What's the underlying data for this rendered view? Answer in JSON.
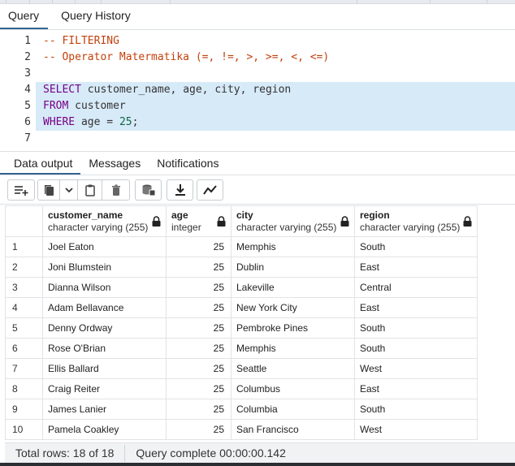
{
  "query_tabs": [
    {
      "label": "Query",
      "active": true
    },
    {
      "label": "Query History",
      "active": false
    }
  ],
  "editor": {
    "lines": [
      {
        "n": "1",
        "tokens": [
          {
            "t": "-- FILTERING",
            "c": "comment"
          }
        ]
      },
      {
        "n": "2",
        "tokens": [
          {
            "t": "-- Operator Matermatika (=, !=, >, >=, <, <=)",
            "c": "comment"
          }
        ]
      },
      {
        "n": "3",
        "tokens": []
      },
      {
        "n": "4",
        "tokens": [
          {
            "t": "SELECT",
            "c": "kw"
          },
          {
            "t": " customer_name, age, city, region",
            "c": "plain"
          }
        ],
        "selected": true
      },
      {
        "n": "5",
        "tokens": [
          {
            "t": "FROM",
            "c": "kw"
          },
          {
            "t": " customer",
            "c": "plain"
          }
        ],
        "selected": true
      },
      {
        "n": "6",
        "tokens": [
          {
            "t": "WHERE",
            "c": "kw"
          },
          {
            "t": " age = ",
            "c": "plain"
          },
          {
            "t": "25",
            "c": "num"
          },
          {
            "t": ";",
            "c": "plain"
          }
        ],
        "selected": true
      },
      {
        "n": "7",
        "tokens": []
      }
    ]
  },
  "output_tabs": [
    {
      "label": "Data output",
      "active": true
    },
    {
      "label": "Messages",
      "active": false
    },
    {
      "label": "Notifications",
      "active": false
    }
  ],
  "toolbar": {
    "icons": [
      "add-row-icon",
      "copy-icon",
      "chevron-down-icon",
      "paste-icon",
      "delete-icon",
      "save-data-icon",
      "download-icon",
      "graph-icon"
    ]
  },
  "grid": {
    "columns": [
      {
        "name": "customer_name",
        "type": "character varying (255)"
      },
      {
        "name": "age",
        "type": "integer"
      },
      {
        "name": "city",
        "type": "character varying (255)"
      },
      {
        "name": "region",
        "type": "character varying (255)"
      }
    ],
    "rows": [
      [
        "1",
        "Joel Eaton",
        "25",
        "Memphis",
        "South"
      ],
      [
        "2",
        "Joni Blumstein",
        "25",
        "Dublin",
        "East"
      ],
      [
        "3",
        "Dianna Wilson",
        "25",
        "Lakeville",
        "Central"
      ],
      [
        "4",
        "Adam Bellavance",
        "25",
        "New York City",
        "East"
      ],
      [
        "5",
        "Denny Ordway",
        "25",
        "Pembroke Pines",
        "South"
      ],
      [
        "6",
        "Rose O'Brian",
        "25",
        "Memphis",
        "South"
      ],
      [
        "7",
        "Ellis Ballard",
        "25",
        "Seattle",
        "West"
      ],
      [
        "8",
        "Craig Reiter",
        "25",
        "Columbus",
        "East"
      ],
      [
        "9",
        "James Lanier",
        "25",
        "Columbia",
        "South"
      ],
      [
        "10",
        "Pamela Coakley",
        "25",
        "San Francisco",
        "West"
      ]
    ]
  },
  "status": {
    "total_rows": "Total rows: 18 of 18",
    "query_complete": "Query complete 00:00:00.142"
  },
  "colors": {
    "accent": "#326690",
    "selection": "#d7eaf8",
    "comment": "#c2410c",
    "keyword": "#770088",
    "number": "#116644"
  }
}
